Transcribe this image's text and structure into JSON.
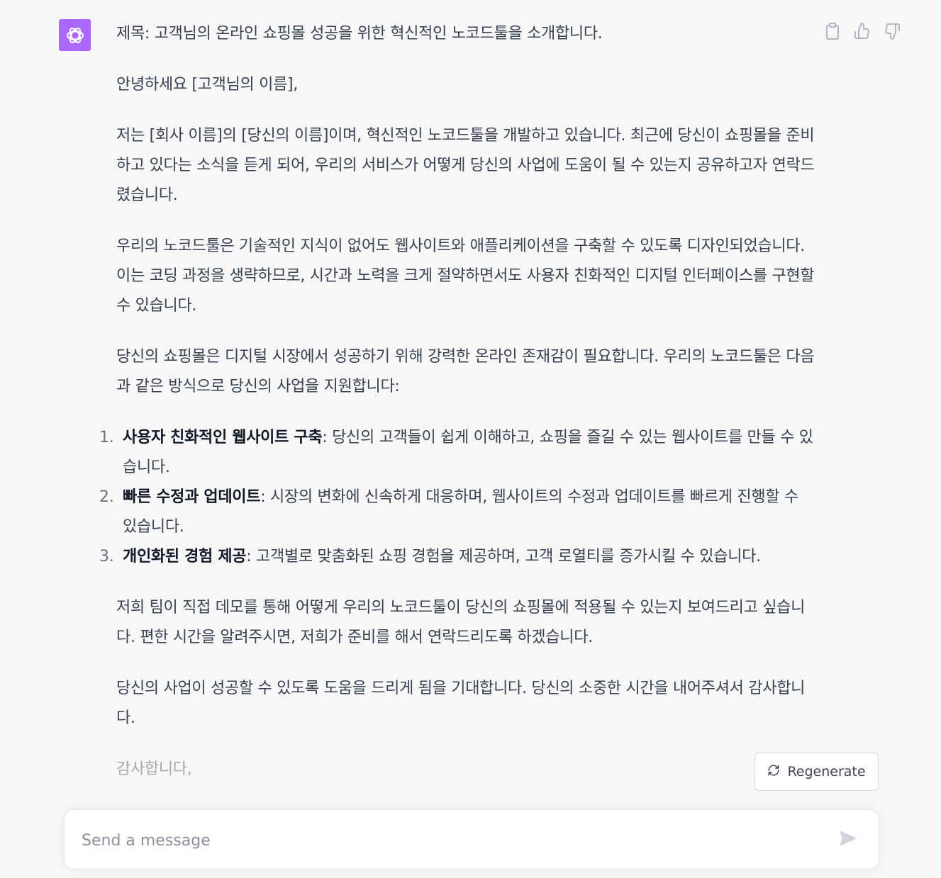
{
  "message": {
    "subject": "제목: 고객님의 온라인 쇼핑몰 성공을 위한 혁신적인 노코드툴을 소개합니다.",
    "greeting": "안녕하세요 [고객님의 이름],",
    "paragraph1": "저는 [회사 이름]의 [당신의 이름]이며, 혁신적인 노코드툴을 개발하고 있습니다. 최근에 당신이 쇼핑몰을 준비하고 있다는 소식을 듣게 되어, 우리의 서비스가 어떻게 당신의 사업에 도움이 될 수 있는지 공유하고자 연락드렸습니다.",
    "paragraph2": "우리의 노코드툴은 기술적인 지식이 없어도 웹사이트와 애플리케이션을 구축할 수 있도록 디자인되었습니다. 이는 코딩 과정을 생략하므로, 시간과 노력을 크게 절약하면서도 사용자 친화적인 디지털 인터페이스를 구현할 수 있습니다.",
    "paragraph3": "당신의 쇼핑몰은 디지털 시장에서 성공하기 위해 강력한 온라인 존재감이 필요합니다. 우리의 노코드툴은 다음과 같은 방식으로 당신의 사업을 지원합니다:",
    "list": [
      {
        "number": "1.",
        "title": "사용자 친화적인 웹사이트 구축",
        "text": ": 당신의 고객들이 쉽게 이해하고, 쇼핑을 즐길 수 있는 웹사이트를 만들 수 있습니다."
      },
      {
        "number": "2.",
        "title": "빠른 수정과 업데이트",
        "text": ": 시장의 변화에 신속하게 대응하며, 웹사이트의 수정과 업데이트를 빠르게 진행할 수 있습니다."
      },
      {
        "number": "3.",
        "title": "개인화된 경험 제공",
        "text": ": 고객별로 맞춤화된 쇼핑 경험을 제공하며, 고객 로열티를 증가시킬 수 있습니다."
      }
    ],
    "paragraph4": "저희 팀이 직접 데모를 통해 어떻게 우리의 노코드툴이 당신의 쇼핑몰에 적용될 수 있는지 보여드리고 싶습니다. 편한 시간을 알려주시면, 저희가 준비를 해서 연락드리도록 하겠습니다.",
    "paragraph5": "당신의 사업이 성공할 수 있도록 도움을 드리게 됨을 기대합니다. 당신의 소중한 시간을 내어주셔서 감사합니다.",
    "closing": "감사합니다,"
  },
  "actions": {
    "regenerate_label": "Regenerate"
  },
  "composer": {
    "placeholder": "Send a message"
  },
  "icons": {
    "avatar": "openai-logo-icon",
    "copy": "clipboard-icon",
    "like": "thumbs-up-icon",
    "dislike": "thumbs-down-icon",
    "regenerate": "refresh-icon",
    "send": "send-icon"
  },
  "colors": {
    "avatar_bg": "#ab68ff",
    "page_bg": "#f7f7f8",
    "text": "#374151"
  }
}
